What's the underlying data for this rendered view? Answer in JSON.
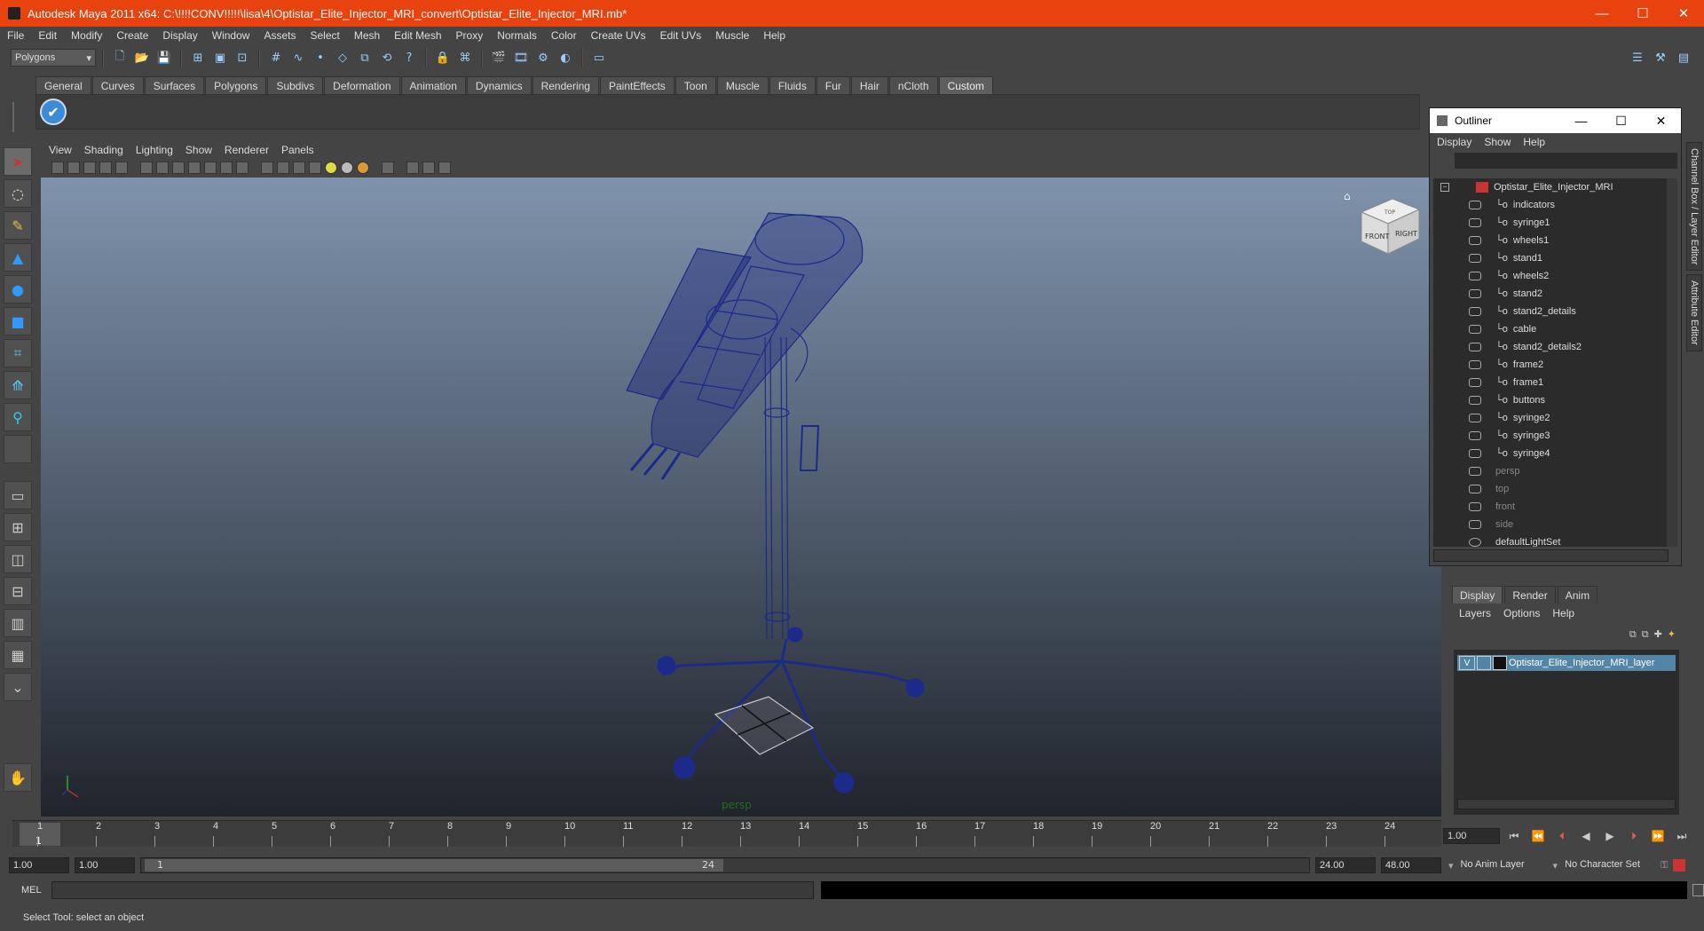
{
  "window": {
    "title": "Autodesk Maya 2011 x64: C:\\!!!!CONV!!!!!\\lisa\\4\\Optistar_Elite_Injector_MRI_convert\\Optistar_Elite_Injector_MRI.mb*",
    "minimize": "—",
    "maximize": "☐",
    "close": "✕"
  },
  "menubar": [
    "File",
    "Edit",
    "Modify",
    "Create",
    "Display",
    "Window",
    "Assets",
    "Select",
    "Mesh",
    "Edit Mesh",
    "Proxy",
    "Normals",
    "Color",
    "Create UVs",
    "Edit UVs",
    "Muscle",
    "Help"
  ],
  "statusline": {
    "mode": "Polygons"
  },
  "shelf": {
    "tabs": [
      "General",
      "Curves",
      "Surfaces",
      "Polygons",
      "Subdivs",
      "Deformation",
      "Animation",
      "Dynamics",
      "Rendering",
      "PaintEffects",
      "Toon",
      "Muscle",
      "Fluids",
      "Fur",
      "Hair",
      "nCloth",
      "Custom"
    ],
    "active": "Custom"
  },
  "viewport": {
    "menus": [
      "View",
      "Shading",
      "Lighting",
      "Show",
      "Renderer",
      "Panels"
    ],
    "camera": "persp",
    "viewcube": {
      "front": "FRONT",
      "right": "RIGHT",
      "top": "TOP"
    }
  },
  "outliner": {
    "title": "Outliner",
    "menus": [
      "Display",
      "Show",
      "Help"
    ],
    "root": "Optistar_Elite_Injector_MRI",
    "children": [
      "indicators",
      "syringe1",
      "wheels1",
      "stand1",
      "wheels2",
      "stand2",
      "stand2_details",
      "cable",
      "stand2_details2",
      "frame2",
      "frame1",
      "buttons",
      "syringe2",
      "syringe3",
      "syringe4"
    ],
    "cameras": [
      "persp",
      "top",
      "front",
      "side"
    ],
    "sets": [
      "defaultLightSet"
    ]
  },
  "sidetabs": [
    "Channel Box / Layer Editor",
    "Attribute Editor"
  ],
  "layer_editor": {
    "tabs": [
      "Display",
      "Render",
      "Anim"
    ],
    "active": "Display",
    "menus": [
      "Layers",
      "Options",
      "Help"
    ],
    "layer": {
      "visible": "V",
      "name": "Optistar_Elite_Injector_MRI_layer"
    }
  },
  "timeline": {
    "ticks": [
      "1",
      "2",
      "3",
      "4",
      "5",
      "6",
      "7",
      "8",
      "9",
      "10",
      "11",
      "12",
      "13",
      "14",
      "15",
      "16",
      "17",
      "18",
      "19",
      "20",
      "21",
      "22",
      "23",
      "24"
    ],
    "current_frame": "1.00",
    "current_marker": "1"
  },
  "range": {
    "start": "1.00",
    "playback_start": "1.00",
    "slider_start": "1",
    "slider_end": "24",
    "playback_end": "24.00",
    "end": "48.00",
    "anim_layer": "No Anim Layer",
    "character_set": "No Character Set"
  },
  "command_line": {
    "label": "MEL"
  },
  "help_line": "Select Tool: select an object"
}
